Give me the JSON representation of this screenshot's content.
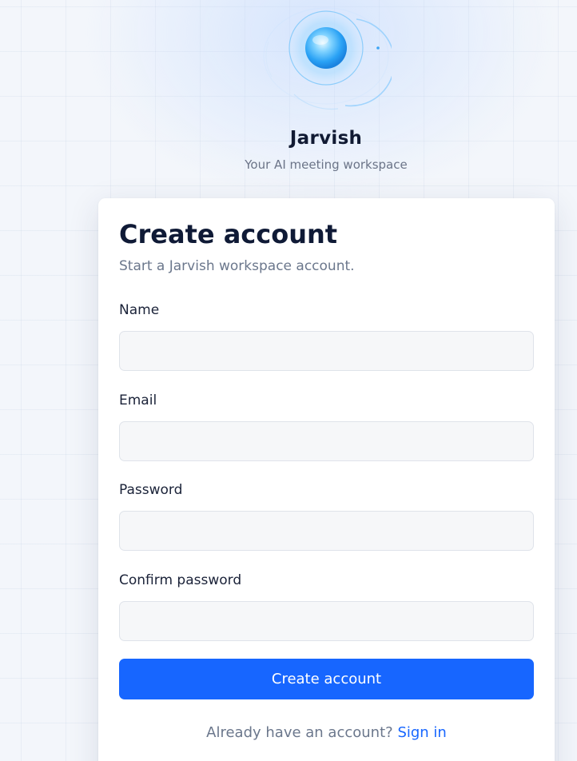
{
  "brand": {
    "name": "Jarvish",
    "tagline": "Your AI meeting workspace"
  },
  "card": {
    "title": "Create account",
    "subtitle": "Start a Jarvish workspace account."
  },
  "form": {
    "name": {
      "label": "Name",
      "value": "",
      "placeholder": ""
    },
    "email": {
      "label": "Email",
      "value": "",
      "placeholder": ""
    },
    "password": {
      "label": "Password",
      "value": "",
      "placeholder": ""
    },
    "confirm_password": {
      "label": "Confirm password",
      "value": "",
      "placeholder": ""
    },
    "submit_label": "Create account"
  },
  "footer": {
    "prompt": "Already have an account?",
    "signin_label": "Sign in"
  },
  "colors": {
    "accent": "#1766ff",
    "title": "#0f1a36",
    "muted": "#6b778c",
    "input_bg": "#f6f7f9"
  },
  "icons": {
    "logo": "glowing-orb-logo-icon"
  }
}
